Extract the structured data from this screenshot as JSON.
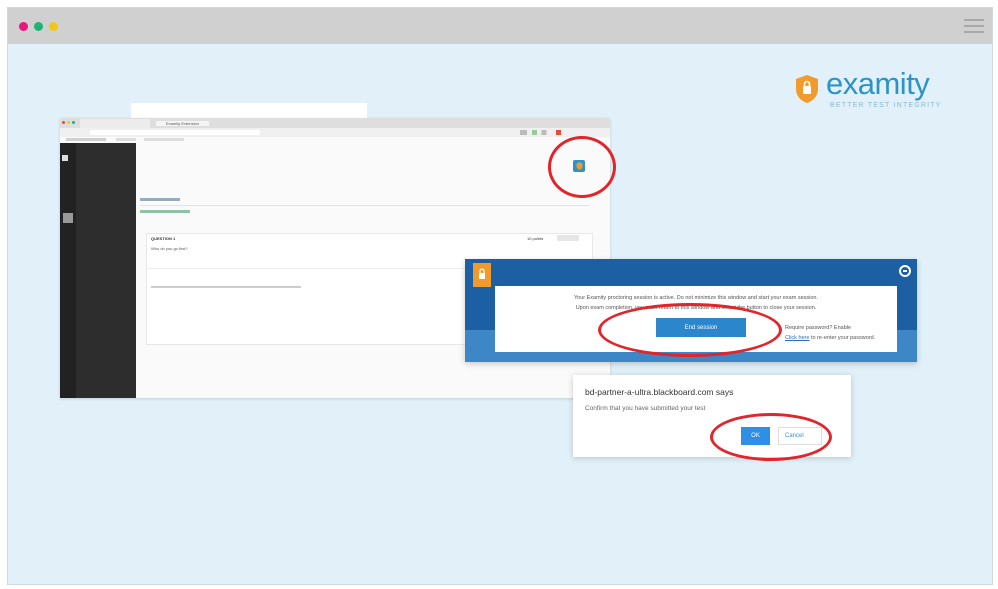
{
  "colors": {
    "background": "#e2f1f9",
    "topbar": "#d0d0d0",
    "dot_red": "#e6187e",
    "dot_green": "#1db374",
    "dot_yellow": "#f5c518",
    "highlight_circle": "#e2242b",
    "examity_blue": "#2e93c6",
    "examity_orange": "#f39a2d",
    "panel_blue": "#1c5fa3",
    "button_blue": "#2b86cc"
  },
  "icons": {
    "window_dots": [
      "red-dot",
      "green-dot",
      "yellow-dot"
    ],
    "menu": "hamburger-menu-icon",
    "logo": "examity-shield-icon"
  },
  "logo": {
    "wordmark": "examity",
    "tagline": "BETTER TEST INTEGRITY"
  },
  "browser": {
    "tab_title": "Examity Extension",
    "question_heading": "QUESTION 1",
    "question_text": "Who do you go first?",
    "points": "10 points"
  },
  "examity_panel": {
    "message_line1": "Your Examity proctoring session is active. Do not minimize this window and start your exam session.",
    "message_line2": "Upon exam completion, you must return to this window and select the button to close your session.",
    "end_button": "End session",
    "password_note": "Require password? Enable",
    "password_link": "Click here",
    "password_suffix": "to re-enter your password."
  },
  "dialog": {
    "title": "bd-partner-a-ultra.blackboard.com says",
    "message": "Confirm that you have submitted your test",
    "ok_label": "OK",
    "cancel_label": "Cancel"
  }
}
